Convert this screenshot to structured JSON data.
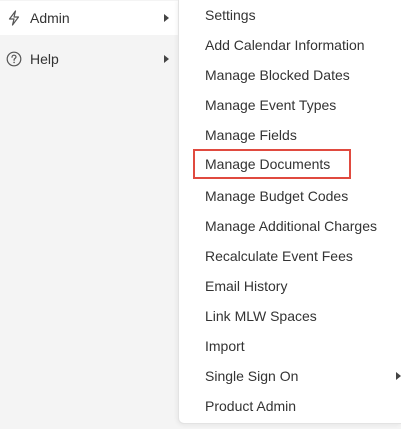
{
  "sidebar": {
    "items": [
      {
        "label": "Admin",
        "icon": "lightning-icon"
      },
      {
        "label": "Help",
        "icon": "question-circle-icon"
      }
    ]
  },
  "submenu": {
    "items": [
      {
        "label": "Settings"
      },
      {
        "label": "Add Calendar Information"
      },
      {
        "label": "Manage Blocked Dates"
      },
      {
        "label": "Manage Event Types"
      },
      {
        "label": "Manage Fields"
      },
      {
        "label": "Manage Documents"
      },
      {
        "label": "Manage Budget Codes"
      },
      {
        "label": "Manage Additional Charges"
      },
      {
        "label": "Recalculate Event Fees"
      },
      {
        "label": "Email History"
      },
      {
        "label": "Link MLW Spaces"
      },
      {
        "label": "Import"
      },
      {
        "label": "Single Sign On"
      },
      {
        "label": "Product Admin"
      }
    ],
    "highlighted": "Manage Documents"
  },
  "colors": {
    "highlight_border": "#e04a3f",
    "text": "#333333",
    "background": "#f4f4f4",
    "menu_background": "#ffffff"
  }
}
